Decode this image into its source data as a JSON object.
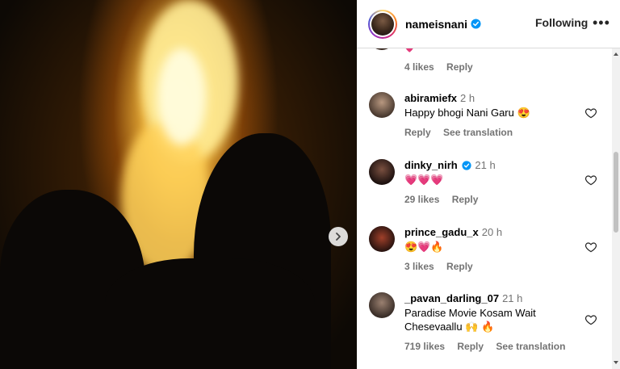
{
  "header": {
    "username": "nameisnani",
    "follow_label": "Following",
    "more_label": "•••"
  },
  "comments": [
    {
      "likes": "4 likes",
      "reply": "Reply",
      "emoji": "💗"
    },
    {
      "user": "abiramiefx",
      "time": "2 h",
      "text": "Happy bhogi Nani Garu 😍",
      "reply": "Reply",
      "translate": "See translation"
    },
    {
      "user": "dinky_nirh",
      "verified": true,
      "time": "21 h",
      "text": "💗💗💗",
      "likes": "29 likes",
      "reply": "Reply"
    },
    {
      "user": "prince_gadu_x",
      "time": "20 h",
      "text": "😍💗🔥",
      "likes": "3 likes",
      "reply": "Reply"
    },
    {
      "user": "_pavan_darling_07",
      "time": "21 h",
      "text_line1": "Paradise Movie Kosam Wait",
      "text_line2": "Chesevaallu 🙌 🔥",
      "likes": "719 likes",
      "reply": "Reply",
      "translate": "See translation"
    }
  ],
  "colors": {
    "verified": "#0095f6",
    "muted": "#737373",
    "border": "#dbdbdb"
  },
  "icons": {
    "next": "chevron-right-icon",
    "like": "heart-outline-icon",
    "more": "more-horizontal-icon"
  }
}
